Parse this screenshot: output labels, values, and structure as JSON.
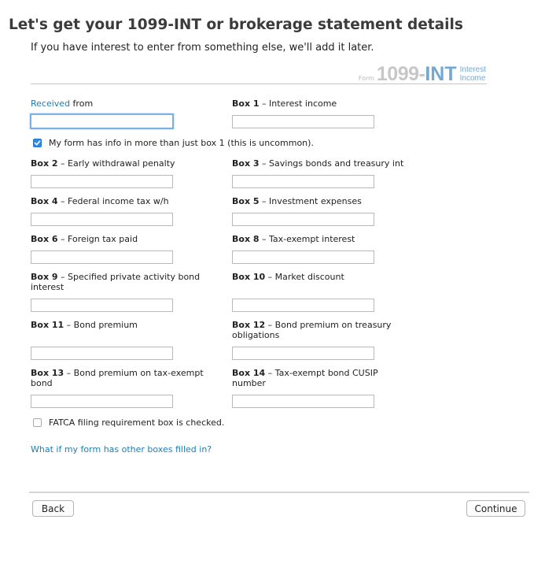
{
  "header": {
    "title": "Let's get your 1099-INT or brokerage statement details",
    "subtitle": "If you have interest to enter from something else, we'll add it later."
  },
  "form_brand": {
    "form_word": "Form",
    "number": "1099-",
    "type": "INT",
    "desc_line1": "Interest",
    "desc_line2": "Income",
    "accent_color": "#73a8d2"
  },
  "fields": {
    "received_from": {
      "link": "Received",
      "rest": " from",
      "value": ""
    },
    "box1": {
      "box": "Box 1",
      "text": " – Interest income",
      "value": ""
    },
    "box2": {
      "box": "Box 2",
      "text": " – Early withdrawal penalty",
      "value": ""
    },
    "box3": {
      "box": "Box 3",
      "text": " – Savings bonds and treasury int",
      "value": ""
    },
    "box4": {
      "box": "Box 4",
      "text": " – Federal income tax w/h",
      "value": ""
    },
    "box5": {
      "box": "Box 5",
      "text": " – Investment expenses",
      "value": ""
    },
    "box6": {
      "box": "Box 6",
      "text": " – Foreign tax paid",
      "value": ""
    },
    "box8": {
      "box": "Box 8",
      "text": " – Tax-exempt interest",
      "value": ""
    },
    "box9": {
      "box": "Box 9",
      "text": " – Specified private activity bond interest",
      "value": ""
    },
    "box10": {
      "box": "Box 10",
      "text": " – Market discount",
      "value": ""
    },
    "box11": {
      "box": "Box 11",
      "text": " – Bond premium",
      "value": ""
    },
    "box12": {
      "box": "Box 12",
      "text": " – Bond premium on treasury obligations",
      "value": ""
    },
    "box13": {
      "box": "Box 13",
      "text": " – Bond premium on tax-exempt bond",
      "value": ""
    },
    "box14": {
      "box": "Box 14",
      "text": " – Tax-exempt bond CUSIP number",
      "value": ""
    }
  },
  "checkboxes": {
    "more_than_box1": {
      "label": "My form has info in more than just box 1 (this is uncommon).",
      "checked": true
    },
    "fatca": {
      "label": "FATCA filing requirement box is checked.",
      "checked": false
    }
  },
  "links": {
    "other_boxes": "What if my form has other boxes filled in?"
  },
  "footer": {
    "back_label": "Back",
    "continue_label": "Continue"
  },
  "colors": {
    "link": "#1e7eb0",
    "checkbox_checked": "#2d8ae6"
  }
}
